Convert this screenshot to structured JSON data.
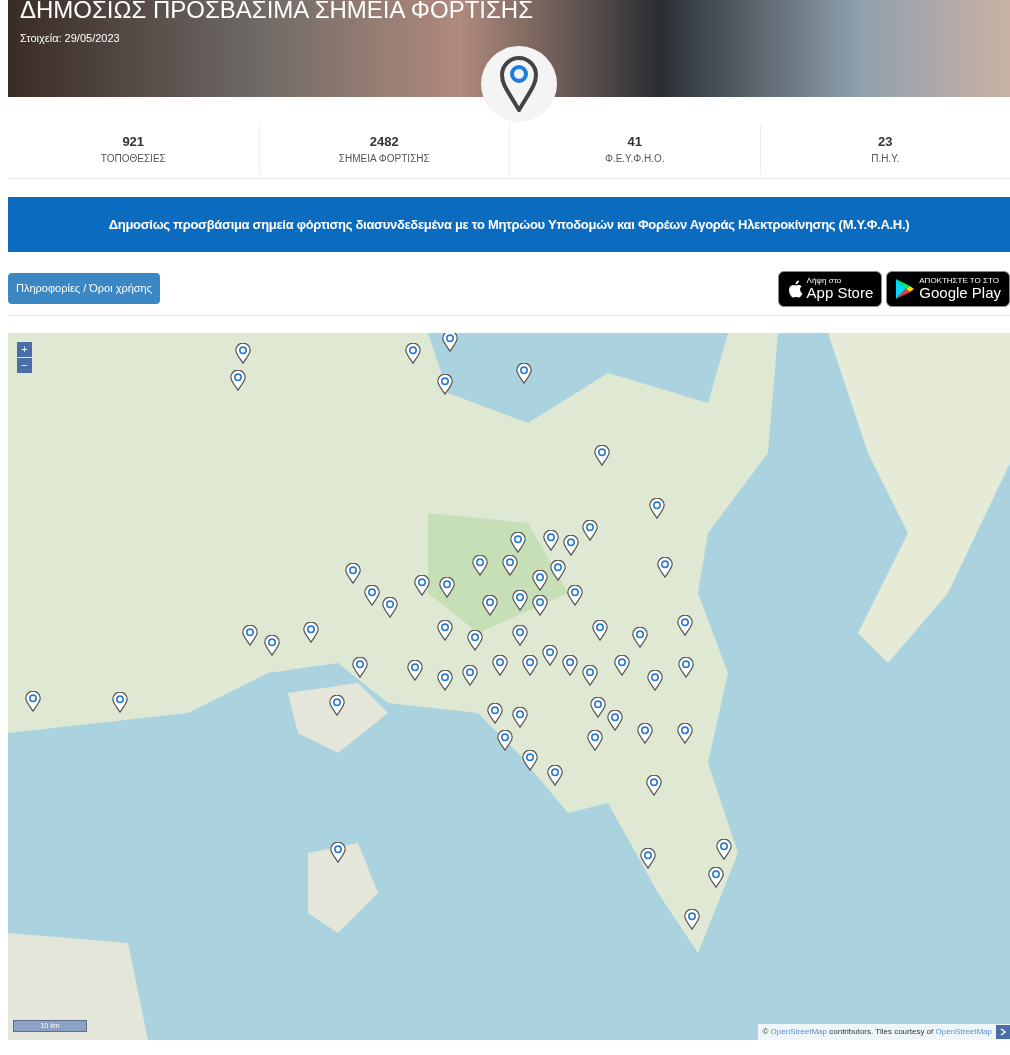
{
  "header": {
    "title": "ΔΗΜΟΣΙΩΣ ΠΡΟΣΒΑΣΙΜΑ ΣΗΜΕΙΑ ΦΟΡΤΙΣΗΣ",
    "subtitle": "Στοιχεία: 29/05/2023"
  },
  "stats": [
    {
      "value": "921",
      "label": "ΤΟΠΟΘΕΣΙΕΣ"
    },
    {
      "value": "2482",
      "label": "ΣΗΜΕΙΑ ΦΟΡΤΙΣΗΣ"
    },
    {
      "value": "41",
      "label": "Φ.Ε.Υ.Φ.Η.Ο."
    },
    {
      "value": "23",
      "label": "Π.Η.Υ."
    }
  ],
  "banner": "Δημοσίως προσβάσιμα σημεία φόρτισης διασυνδεδεμένα με το Μητρώου Υποδομών και Φορέων Αγοράς Ηλεκτροκίνησης (Μ.Υ.Φ.Α.Η.)",
  "info_button": "Πληροφορίες / Όροι χρήσης",
  "stores": [
    {
      "kind": "apple",
      "small": "Λήψη στο",
      "big": "App Store"
    },
    {
      "kind": "google",
      "small": "ΑΠΟΚΤΗΣΤΕ ΤΟ ΣΤΟ",
      "big": "Google Play"
    }
  ],
  "map": {
    "zoom_in": "+",
    "zoom_out": "−",
    "scale": "10 km",
    "attribution": {
      "prefix": "©",
      "link_1": "OpenStreetMap",
      "middle": "contributors. Tiles courtesy of",
      "link_2": "OpenStreetMap"
    }
  }
}
